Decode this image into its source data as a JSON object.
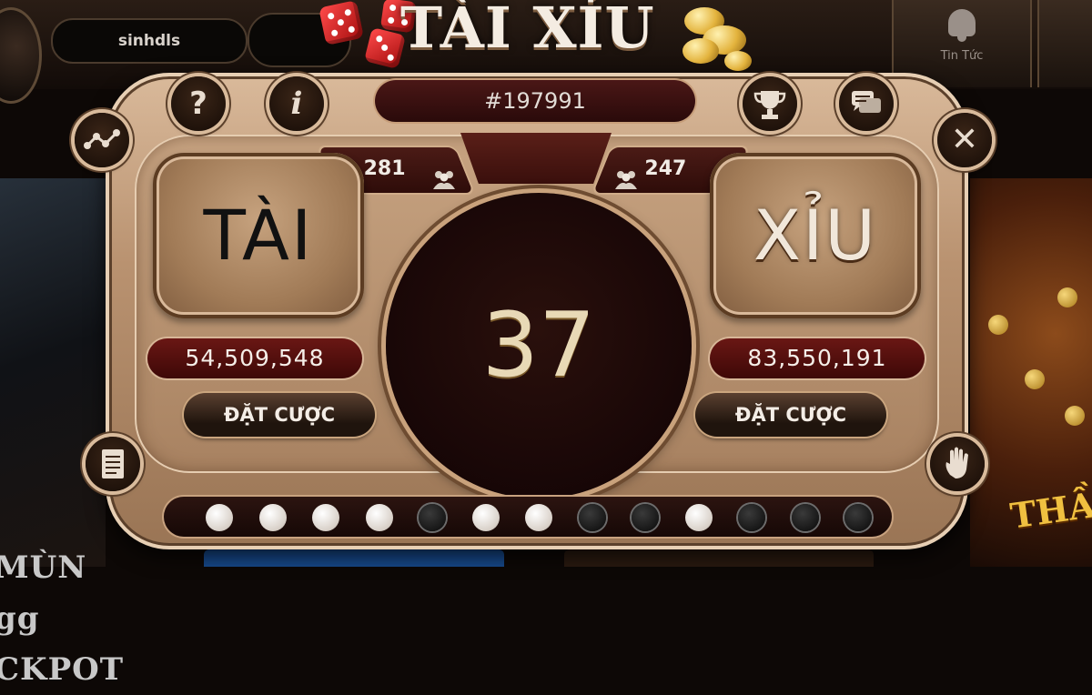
{
  "header": {
    "username": "sinhdls",
    "logo_text": "TÀI XỈU",
    "news_label": "Tin Tức"
  },
  "game": {
    "round_id": "#197991",
    "center_number": "37",
    "tai": {
      "label": "TÀI",
      "players": "281",
      "amount": "54,509,548",
      "bet_label": "ĐẶT CƯỢC"
    },
    "xiu": {
      "label": "XỈU",
      "players": "247",
      "amount": "83,550,191",
      "bet_label": "ĐẶT CƯỢC"
    },
    "history": [
      "white",
      "white",
      "white",
      "white",
      "black",
      "white",
      "white",
      "black",
      "black",
      "white",
      "black",
      "black",
      "black"
    ]
  },
  "buttons": {
    "help": "?",
    "info": "i",
    "close": "✕"
  },
  "background": {
    "left_banner_text": [
      "MÙN",
      "gg",
      "CKPOT"
    ],
    "right_banner_text": "THẦN"
  },
  "colors": {
    "accent_gold": "#d9b99a",
    "dark_red": "#4a1716",
    "amount_red": "#6a1714"
  }
}
